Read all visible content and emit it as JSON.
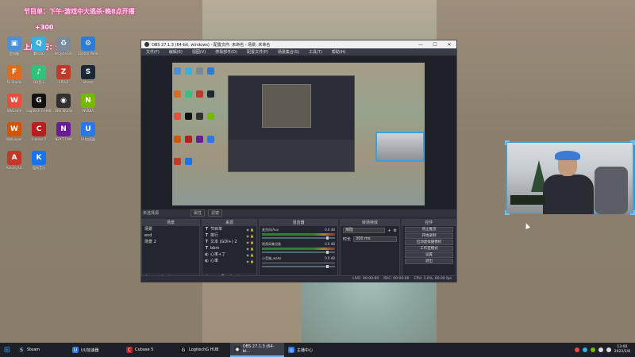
{
  "overlay": {
    "title": "节目单：下午·游戏中大逃杀·晚8点开播",
    "counter": "+300",
    "subtitle": "上周排行：谁是"
  },
  "desktop_icons": [
    {
      "label": "此电脑",
      "color": "#4a90d9",
      "glyph": "▣"
    },
    {
      "label": "腾讯QQ",
      "color": "#3ab0e0",
      "glyph": "Q"
    },
    {
      "label": "Recycle Bin",
      "color": "#7a8a9a",
      "glyph": "♻"
    },
    {
      "label": "Control Panel",
      "color": "#2e7bd6",
      "glyph": "⚙"
    },
    {
      "label": "FL Studio",
      "color": "#e06a1e",
      "glyph": "F"
    },
    {
      "label": "QQ音乐",
      "color": "#31c27c",
      "glyph": "♪"
    },
    {
      "label": "CPU-Z",
      "color": "#c0392b",
      "glyph": "Z"
    },
    {
      "label": "Steam",
      "color": "#1b2838",
      "glyph": "S"
    },
    {
      "label": "WeGame",
      "color": "#e94e3c",
      "glyph": "W"
    },
    {
      "label": "Logitech G HUB",
      "color": "#111",
      "glyph": "G"
    },
    {
      "label": "OBS Studio",
      "color": "#303030",
      "glyph": "◉"
    },
    {
      "label": "NVIDIA",
      "color": "#76b900",
      "glyph": "N"
    },
    {
      "label": "Wallpaper",
      "color": "#d35400",
      "glyph": "W"
    },
    {
      "label": "Cubase 5",
      "color": "#b91e1e",
      "glyph": "C"
    },
    {
      "label": "NZXT CAM",
      "color": "#6a1b9a",
      "glyph": "N"
    },
    {
      "label": "UU加速器",
      "color": "#2b77e6",
      "glyph": "U"
    },
    {
      "label": "Among Us",
      "color": "#c0392b",
      "glyph": "A"
    },
    {
      "label": "酷狗音乐",
      "color": "#1a73e8",
      "glyph": "K"
    }
  ],
  "obs": {
    "title": "OBS 27.1.3 (64-bit, windows) - 配置文件: 未命名 - 场景: 未命名",
    "menu": [
      "文件(F)",
      "编辑(E)",
      "视图(V)",
      "停靠部件(D)",
      "配置文件(P)",
      "场景集合(S)",
      "工具(T)",
      "帮助(H)"
    ],
    "dock_title": "未选择源",
    "props_label": "属性",
    "filters_label": "滤镜",
    "scenes_header": "场景",
    "scenes": [
      "场景",
      "end",
      "场景 2"
    ],
    "sources_header": "来源",
    "sources": [
      {
        "name": "节目单",
        "type": "T"
      },
      {
        "name": "排行",
        "type": "T"
      },
      {
        "name": "文本 (GDI+) 2",
        "type": "T"
      },
      {
        "name": "bbm",
        "type": "T"
      },
      {
        "name": "心率+丁",
        "type": "◐"
      },
      {
        "name": "心率",
        "type": "◐"
      }
    ],
    "mixer_header": "混音器",
    "mixer_tracks": [
      {
        "name": "麦克风/Aux",
        "db": "0.0 dB"
      },
      {
        "name": "视频采集设备",
        "db": "0.0 dB"
      },
      {
        "name": "小音箱_wake",
        "db": "0.0 dB"
      }
    ],
    "transitions_header": "转场特效",
    "transition_type": "渐隐",
    "duration_label": "时长",
    "duration_value": "300 ms",
    "controls_header": "控件",
    "controls": [
      "停止推流",
      "开始录制",
      "启动虚拟摄像机",
      "工作室模式",
      "设置",
      "退出"
    ],
    "status": {
      "live": "LIVE: 00:00:00",
      "rec": "REC: 00:00:00",
      "cpu": "CPU: 1.0%, 60.00 fps"
    }
  },
  "taskbar": {
    "items": [
      {
        "label": "Steam",
        "color": "#1b2838",
        "glyph": "S"
      },
      {
        "label": "UU加速器",
        "color": "#2b77e6",
        "glyph": "U"
      },
      {
        "label": "Cubase 5",
        "color": "#b91e1e",
        "glyph": "C"
      },
      {
        "label": "LogitechG HUB",
        "color": "#111",
        "glyph": "G"
      },
      {
        "label": "OBS 27.1.3 (64-bi...",
        "color": "#303030",
        "glyph": "◉"
      },
      {
        "label": "主播中心",
        "color": "#2b77e6",
        "glyph": "◎"
      }
    ],
    "active_index": 4,
    "time": "13:00",
    "date": "2022/2/8"
  }
}
